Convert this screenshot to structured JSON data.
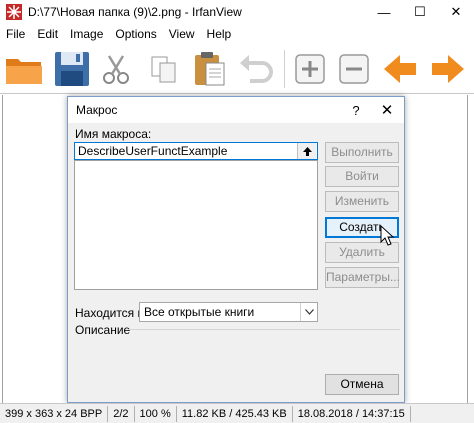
{
  "window": {
    "title": "D:\\77\\Новая папка (9)\\2.png - IrfanView",
    "minimize_glyph": "—",
    "maximize_glyph": "☐",
    "close_glyph": "✕"
  },
  "menu": [
    "File",
    "Edit",
    "Image",
    "Options",
    "View",
    "Help"
  ],
  "toolbar": {
    "icons": [
      "open-folder-icon",
      "save-icon",
      "cut-icon",
      "copy-icon",
      "paste-icon",
      "undo-icon",
      "zoom-in-icon",
      "zoom-out-icon",
      "previous-icon",
      "next-icon"
    ],
    "colors": {
      "folder": "#f39c3c",
      "arrow": "#f08b1e",
      "save": "#5b8fc7"
    }
  },
  "status": {
    "dimensions": "399 x 363 x 24 BPP",
    "index": "2/2",
    "zoom": "100 %",
    "size": "11.82 KB / 425.43 KB",
    "datetime": "18.08.2018 / 14:37:15"
  },
  "dialog": {
    "title": "Макрос",
    "help_glyph": "?",
    "close_glyph": "✕",
    "name_label": "Имя макроса:",
    "name_value": "DescribeUserFunctExample",
    "location_label": "Находится в:",
    "location_value": "Все открытые книги",
    "description_label": "Описание",
    "buttons": {
      "run": "Выполнить",
      "step_into": "Войти",
      "edit": "Изменить",
      "create": "Создать",
      "delete": "Удалить",
      "options": "Параметры...",
      "cancel": "Отмена"
    }
  }
}
